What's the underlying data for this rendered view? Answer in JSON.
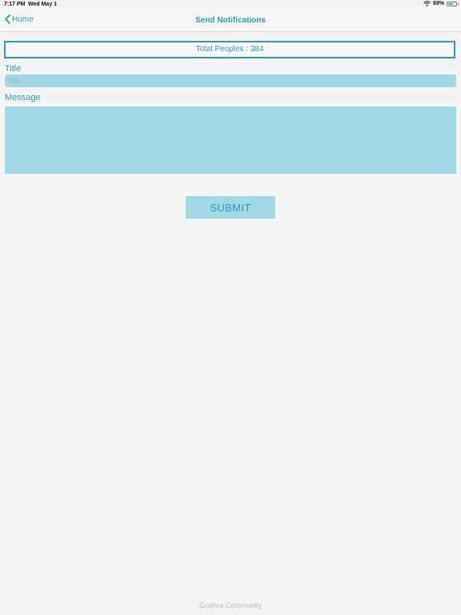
{
  "status_bar": {
    "time": "7:17 PM",
    "date": "Wed May 1",
    "battery_percent_label": "69%",
    "battery_level": 0.69,
    "icons": [
      "wifi-icon",
      "battery-icon"
    ]
  },
  "nav": {
    "back_label": "Home",
    "back_icon": "chevron-left-icon",
    "title": "Send Notifications"
  },
  "summary": {
    "total_label": "Total Peoples : 384"
  },
  "form": {
    "title_label": "Title",
    "title_placeholder": "Title",
    "title_value": "",
    "message_label": "Message",
    "message_value": "",
    "submit_label": "SUBMIT"
  },
  "footer": {
    "text": "Godhra Community"
  },
  "colors": {
    "accent": "#2e9ab8",
    "field_bg": "#a1d6e3",
    "page_bg": "#f4f4f4",
    "battery_green": "#34c759"
  }
}
